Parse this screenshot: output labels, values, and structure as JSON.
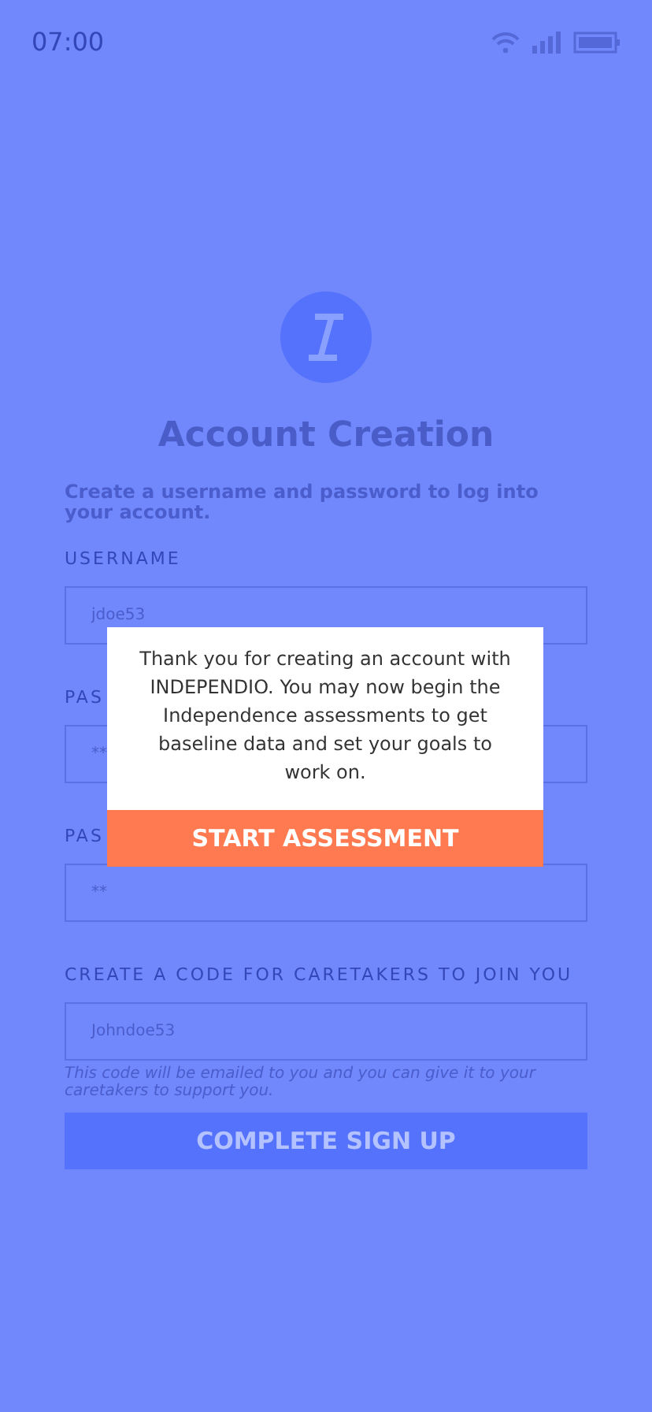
{
  "status_bar": {
    "time": "07:00"
  },
  "title": "Account Creation",
  "subtitle": "Create a username and password to log into your account.",
  "fields": [
    {
      "label": "USERNAME",
      "value": "jdoe53"
    },
    {
      "label": "PAS",
      "value": "**"
    },
    {
      "label": "PAS",
      "value": "**"
    },
    {
      "label": "CREATE A CODE FOR CARETAKERS TO JOIN YOU",
      "value": "Johndoe53",
      "hint": "This code will be emailed to you and you can give it to your caretakers to support you."
    }
  ],
  "submit_button": "COMPLETE SIGN UP",
  "modal": {
    "message": "Thank you for creating an account with INDEPENDIO. You may now begin the Independence assessments to get baseline data and set your goals to work on.",
    "button": "START ASSESSMENT"
  }
}
